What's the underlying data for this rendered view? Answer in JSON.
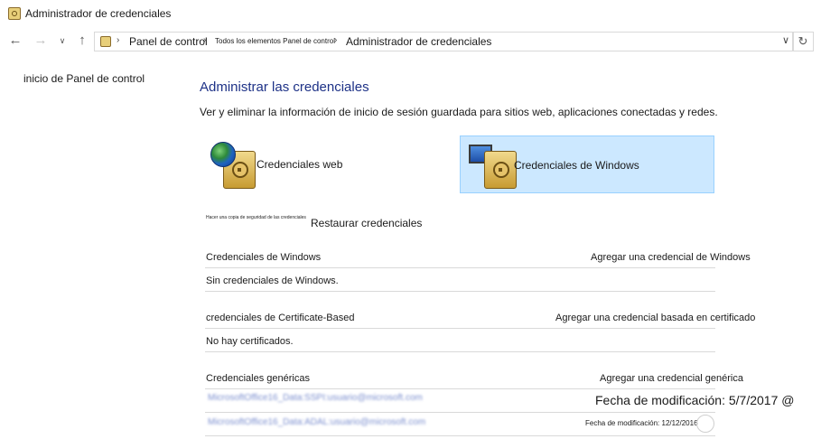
{
  "window": {
    "title": "Administrador de credenciales"
  },
  "nav": {
    "back_icon": "arrow-left-icon",
    "forward_icon": "arrow-right-icon",
    "up_icon": "arrow-up-icon",
    "breadcrumbs": [
      "Panel de control",
      "Todos los elementos Panel de control",
      "Administrador de credenciales"
    ],
    "refresh_icon": "refresh-icon"
  },
  "sidebar": {
    "home_link": "inicio de Panel de control"
  },
  "main": {
    "title": "Administrar las credenciales",
    "subtitle": "Ver y eliminar la información de inicio de sesión guardada para sitios web, aplicaciones conectadas y redes.",
    "tiles": [
      {
        "label": "Credenciales web",
        "selected": false
      },
      {
        "label": "Credenciales de Windows",
        "selected": true
      }
    ],
    "backup_link": "Hacer una copia de seguridad de las credenciales",
    "restore_link": "Restaurar credenciales",
    "sections": [
      {
        "header": "Credenciales de Windows",
        "add": "Agregar una credencial de Windows",
        "empty": "Sin credenciales de Windows."
      },
      {
        "header": "credenciales de Certificate-Based",
        "add": "Agregar una credencial basada en certificado",
        "empty": "No hay certificados."
      },
      {
        "header": "Credenciales genéricas",
        "add": "Agregar una credencial genérica"
      }
    ],
    "generic_items": [
      {
        "name": "MicrosoftOffice16_Data:SSPI:usuario@microsoft.com",
        "modified": "Fecha de modificación: 5/7/2017 @"
      },
      {
        "name": "MicrosoftOffice16_Data:ADAL:usuario@microsoft.com",
        "modified": "Fecha de modificación: 12/12/2016"
      }
    ]
  },
  "colors": {
    "selected_tile": "#cce8ff",
    "title_blue": "#1e3287"
  }
}
